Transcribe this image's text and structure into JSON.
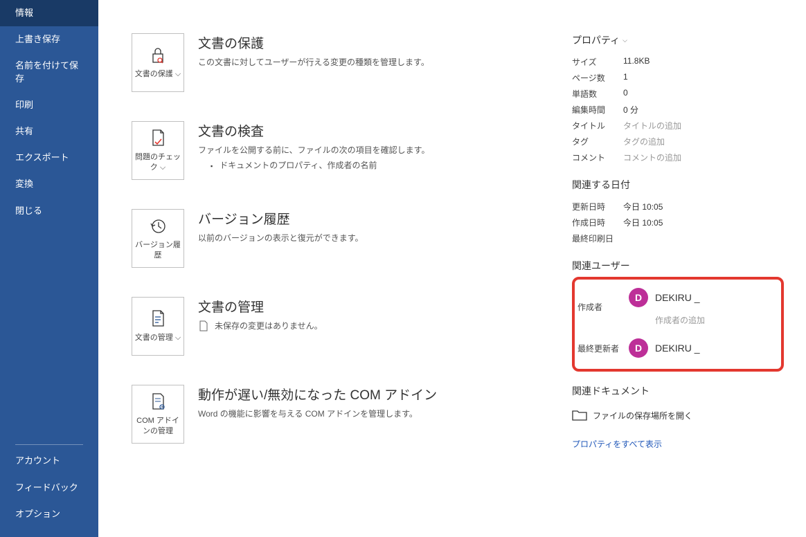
{
  "sidebar": {
    "items": [
      {
        "label": "情報"
      },
      {
        "label": "上書き保存"
      },
      {
        "label": "名前を付けて保存"
      },
      {
        "label": "印刷"
      },
      {
        "label": "共有"
      },
      {
        "label": "エクスポート"
      },
      {
        "label": "変換"
      },
      {
        "label": "閉じる"
      }
    ],
    "bottom": [
      {
        "label": "アカウント"
      },
      {
        "label": "フィードバック"
      },
      {
        "label": "オプション"
      }
    ]
  },
  "sections": {
    "protect": {
      "tile": "文書の保護 ⌵",
      "title": "文書の保護",
      "desc": "この文書に対してユーザーが行える変更の種類を管理します。"
    },
    "inspect": {
      "tile": "問題のチェック ⌵",
      "title": "文書の検査",
      "desc": "ファイルを公開する前に、ファイルの次の項目を確認します。",
      "bullet": "ドキュメントのプロパティ、作成者の名前"
    },
    "history": {
      "tile": "バージョン履歴",
      "title": "バージョン履歴",
      "desc": "以前のバージョンの表示と復元ができます。"
    },
    "manage": {
      "tile": "文書の管理 ⌵",
      "title": "文書の管理",
      "none": "未保存の変更はありません。"
    },
    "com": {
      "tile": "COM アドインの管理",
      "title": "動作が遅い/無効になった COM アドイン",
      "desc": "Word の機能に影響を与える COM アドインを管理します。"
    }
  },
  "props": {
    "header": "プロパティ",
    "size_label": "サイズ",
    "size_val": "11.8KB",
    "pages_label": "ページ数",
    "pages_val": "1",
    "words_label": "単語数",
    "words_val": "0",
    "edit_label": "編集時間",
    "edit_val": "0 分",
    "title_label": "タイトル",
    "title_val": "タイトルの追加",
    "tag_label": "タグ",
    "tag_val": "タグの追加",
    "comment_label": "コメント",
    "comment_val": "コメントの追加"
  },
  "dates": {
    "header": "関連する日付",
    "modified_label": "更新日時",
    "modified_val": "今日 10:05",
    "created_label": "作成日時",
    "created_val": "今日 10:05",
    "printed_label": "最終印刷日",
    "printed_val": ""
  },
  "users": {
    "header": "関連ユーザー",
    "author_label": "作成者",
    "author_initial": "D",
    "author_name": "DEKIRU _",
    "add_author": "作成者の追加",
    "lastmod_label": "最終更新者",
    "lastmod_initial": "D",
    "lastmod_name": "DEKIRU _"
  },
  "docs": {
    "header": "関連ドキュメント",
    "open_location": "ファイルの保存場所を開く"
  },
  "all_props": "プロパティをすべて表示"
}
